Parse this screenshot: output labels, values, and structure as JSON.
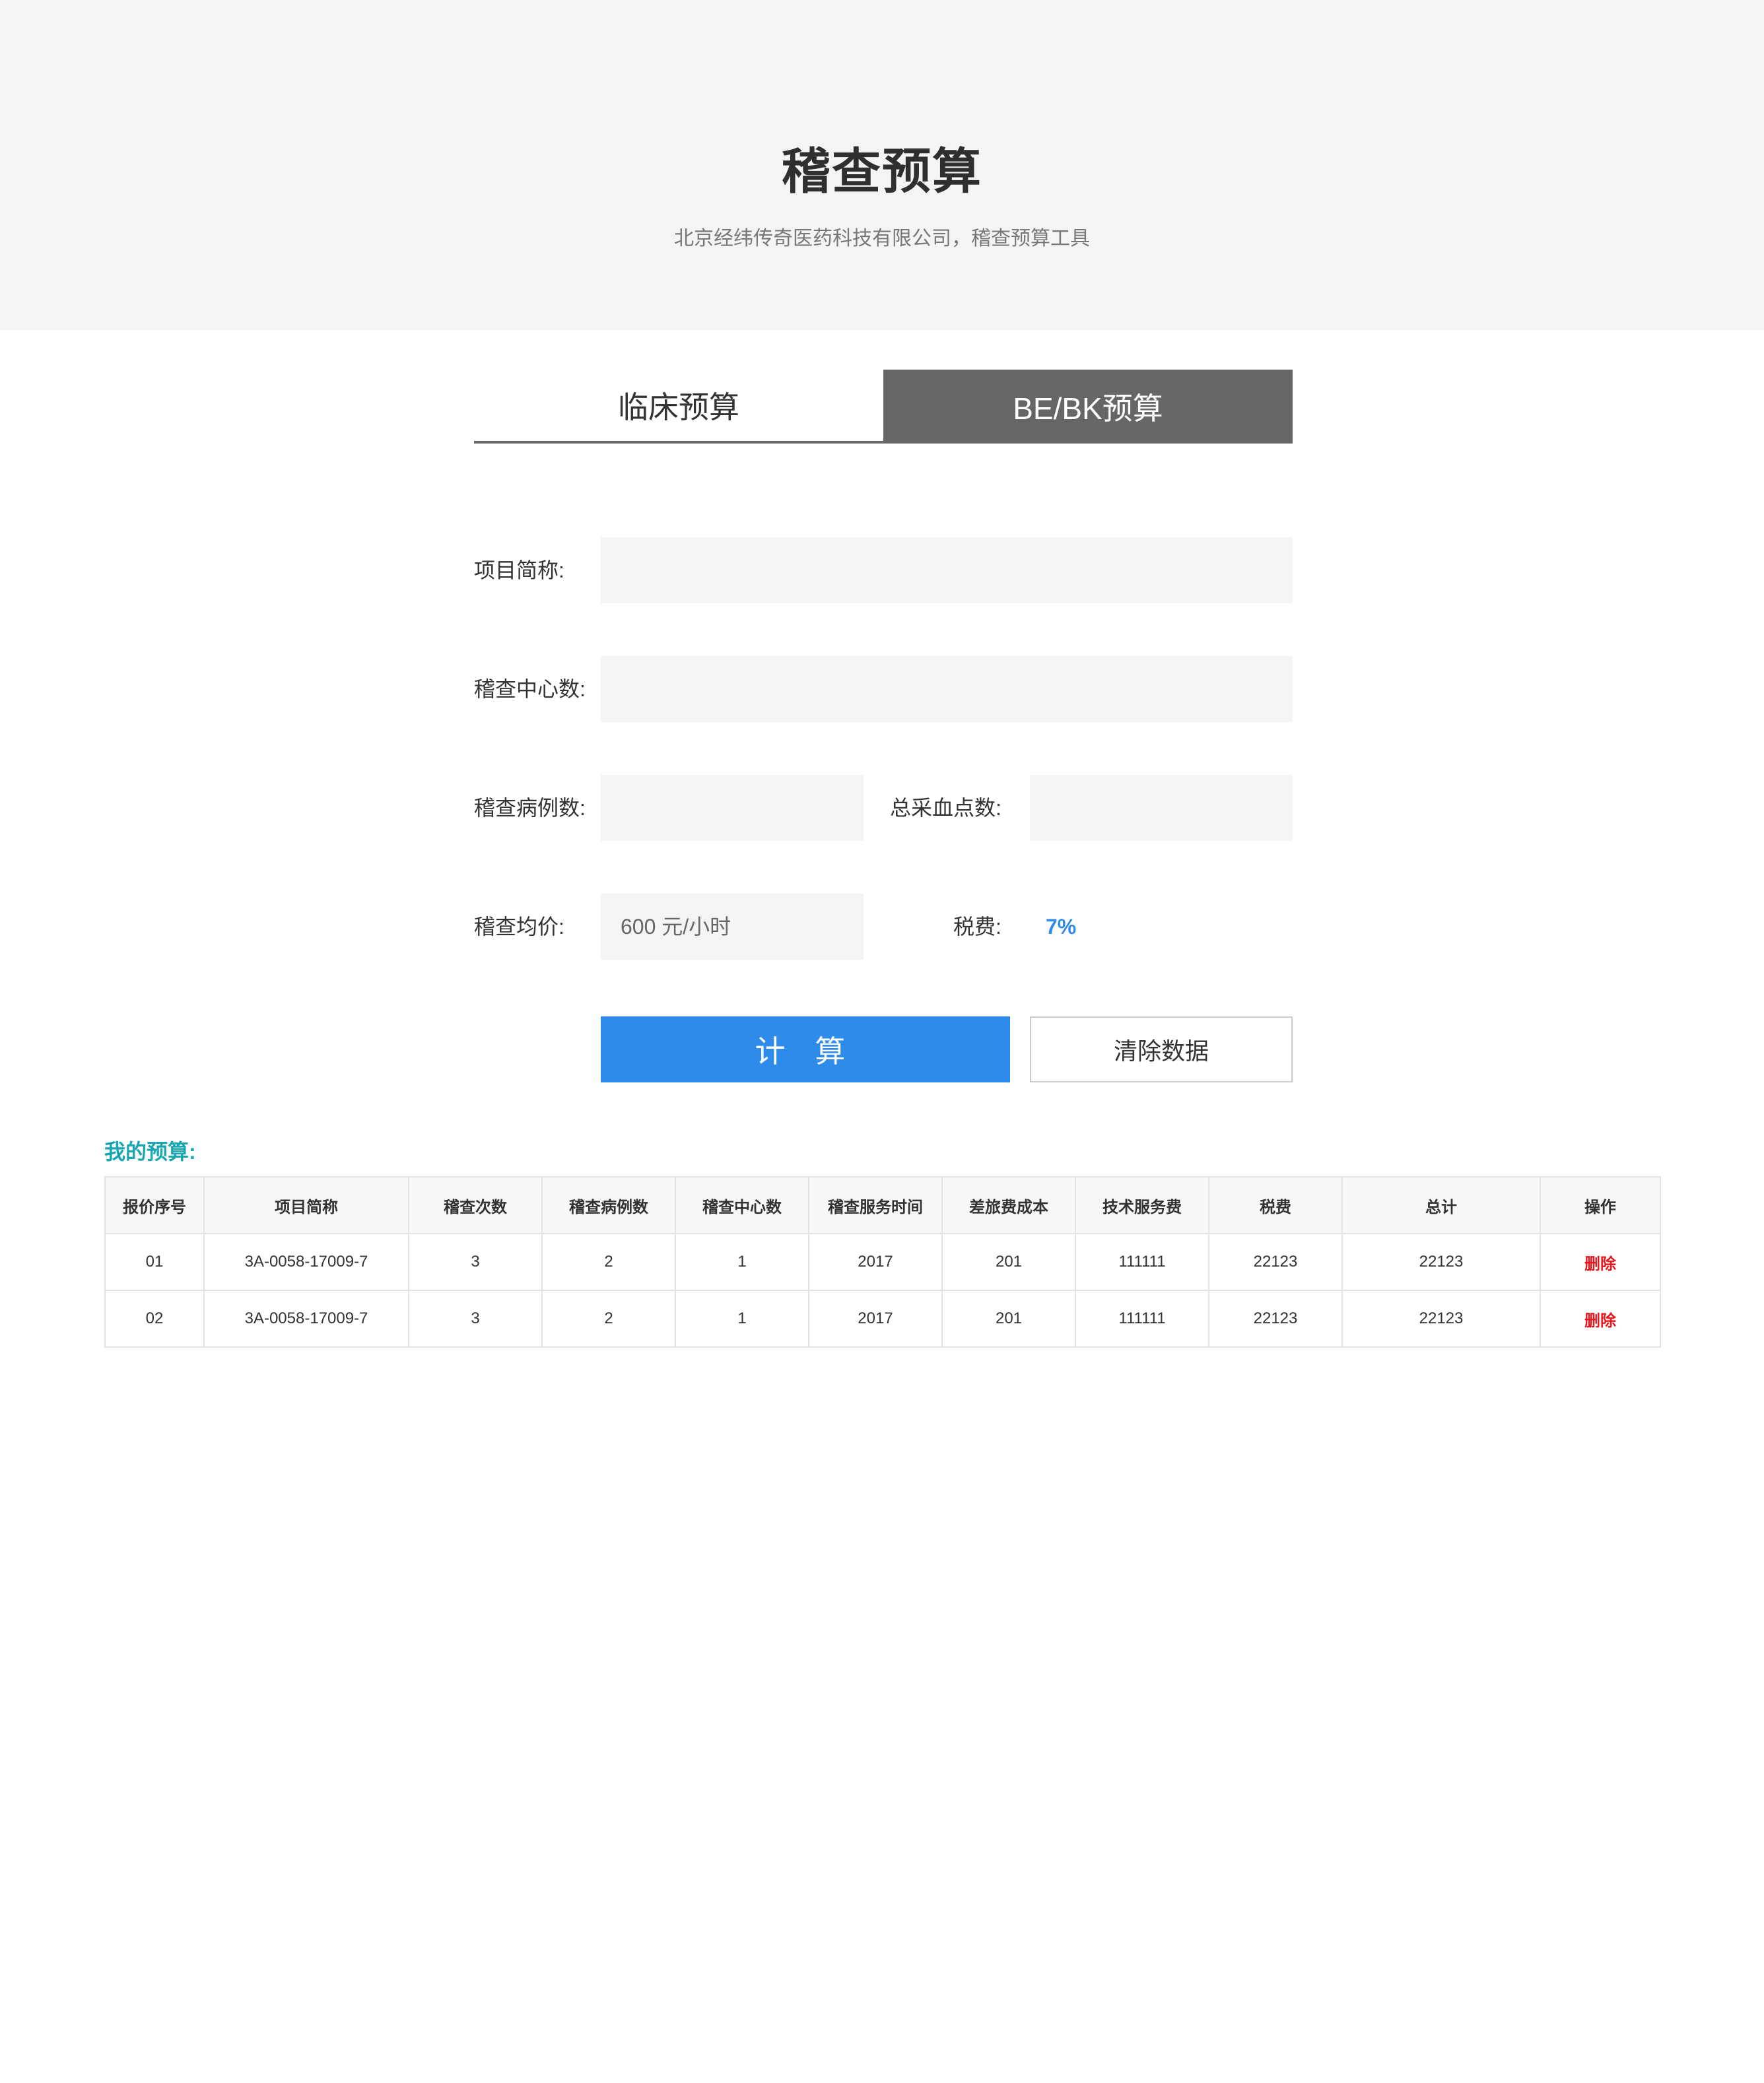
{
  "header": {
    "title": "稽查预算",
    "subtitle": "北京经纬传奇医药科技有限公司，稽查预算工具"
  },
  "tabs": [
    {
      "label": "临床预算",
      "active": false
    },
    {
      "label": "BE/BK预算",
      "active": true
    }
  ],
  "form": {
    "project_name_label": "项目简称:",
    "project_name_value": "",
    "center_count_label": "稽查中心数:",
    "center_count_value": "",
    "case_count_label": "稽查病例数:",
    "case_count_value": "",
    "blood_points_label": "总采血点数:",
    "blood_points_value": "",
    "avg_price_label": "稽查均价:",
    "avg_price_placeholder": "600 元/小时",
    "tax_label": "税费:",
    "tax_value": "7%"
  },
  "buttons": {
    "calculate": "计 算",
    "clear": "清除数据"
  },
  "budget": {
    "title": "我的预算:",
    "columns": [
      "报价序号",
      "项目简称",
      "稽查次数",
      "稽查病例数",
      "稽查中心数",
      "稽查服务时间",
      "差旅费成本",
      "技术服务费",
      "税费",
      "总计",
      "操作"
    ],
    "rows": [
      [
        "01",
        "3A-0058-17009-7",
        "3",
        "2",
        "1",
        "2017",
        "201",
        "111111",
        "22123",
        "22123",
        "删除"
      ],
      [
        "02",
        "3A-0058-17009-7",
        "3",
        "2",
        "1",
        "2017",
        "201",
        "111111",
        "22123",
        "22123",
        "删除"
      ]
    ]
  },
  "colors": {
    "header_bg": "#f4f4f4",
    "accent_blue": "#2f8bea",
    "teal": "#18a7b2",
    "delete_red": "#e8151b",
    "tab_active_bg": "#666666"
  }
}
